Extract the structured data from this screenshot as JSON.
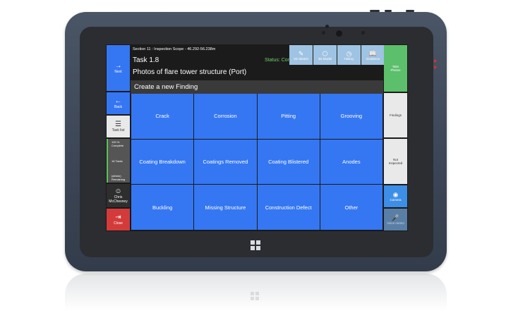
{
  "left_nav": {
    "next": {
      "icon": "arrow-right-icon",
      "label": "Next"
    },
    "back": {
      "icon": "arrow-left-icon",
      "label": "Back"
    },
    "task_list": {
      "icon": "menu-icon",
      "label": "Task list"
    },
    "status": {
      "complete": "100 %\nComplete",
      "tasks": "16 Tasks",
      "remaining": "(##min)\nRemaining"
    },
    "user": {
      "icon": "user-icon",
      "name": "Chris\nMcChesney"
    },
    "close": {
      "icon": "exit-icon",
      "label": "Close"
    }
  },
  "header": {
    "meta": "Section 11 : Inspection Scope - 46.292-56.238m",
    "task": "Task  1.8",
    "status": "Status: Complete",
    "title": "Photos of flare tower structure (Port)",
    "tools": [
      {
        "icon": "sketch-icon",
        "label": "2D Sketch"
      },
      {
        "icon": "cube-icon",
        "label": "3D Model"
      },
      {
        "icon": "clock-icon",
        "label": "History"
      },
      {
        "icon": "book-icon",
        "label": "Guidance"
      }
    ]
  },
  "panel": {
    "heading": "Create a new Finding",
    "findings": [
      "Crack",
      "Corrosion",
      "Pitting",
      "Grooving",
      "Coating Breakdown",
      "Coatings Removed",
      "Coating Blistered",
      "Anodes",
      "Buckling",
      "Missing Structure",
      "Construction Defect",
      "Other"
    ]
  },
  "right_nav": {
    "take_photos": "Take\nPhotos",
    "findings": "Findings",
    "not_inspected": "Not\nInspected",
    "camera": {
      "icon": "camera-icon",
      "label": "Camera"
    },
    "voice": {
      "icon": "microphone-icon",
      "label": "Voice memo"
    }
  },
  "colors": {
    "tile": "#3577f2",
    "next": "#3577f2",
    "close": "#d33b3b",
    "take_photos": "#5cbf6b",
    "tool": "#9fc3e2",
    "status": "#6fd16f"
  }
}
